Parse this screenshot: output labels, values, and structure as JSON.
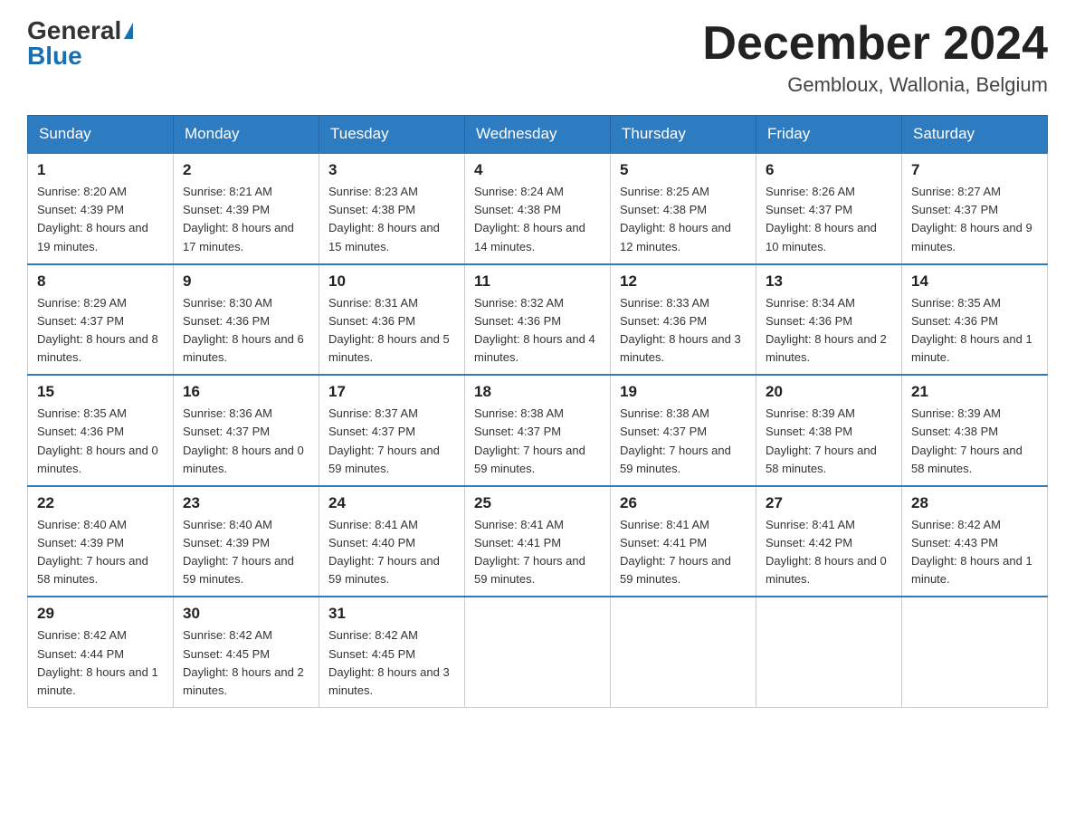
{
  "header": {
    "logo_general": "General",
    "logo_blue": "Blue",
    "month_title": "December 2024",
    "location": "Gembloux, Wallonia, Belgium"
  },
  "days_of_week": [
    "Sunday",
    "Monday",
    "Tuesday",
    "Wednesday",
    "Thursday",
    "Friday",
    "Saturday"
  ],
  "weeks": [
    [
      {
        "day": "1",
        "sunrise": "8:20 AM",
        "sunset": "4:39 PM",
        "daylight": "8 hours and 19 minutes."
      },
      {
        "day": "2",
        "sunrise": "8:21 AM",
        "sunset": "4:39 PM",
        "daylight": "8 hours and 17 minutes."
      },
      {
        "day": "3",
        "sunrise": "8:23 AM",
        "sunset": "4:38 PM",
        "daylight": "8 hours and 15 minutes."
      },
      {
        "day": "4",
        "sunrise": "8:24 AM",
        "sunset": "4:38 PM",
        "daylight": "8 hours and 14 minutes."
      },
      {
        "day": "5",
        "sunrise": "8:25 AM",
        "sunset": "4:38 PM",
        "daylight": "8 hours and 12 minutes."
      },
      {
        "day": "6",
        "sunrise": "8:26 AM",
        "sunset": "4:37 PM",
        "daylight": "8 hours and 10 minutes."
      },
      {
        "day": "7",
        "sunrise": "8:27 AM",
        "sunset": "4:37 PM",
        "daylight": "8 hours and 9 minutes."
      }
    ],
    [
      {
        "day": "8",
        "sunrise": "8:29 AM",
        "sunset": "4:37 PM",
        "daylight": "8 hours and 8 minutes."
      },
      {
        "day": "9",
        "sunrise": "8:30 AM",
        "sunset": "4:36 PM",
        "daylight": "8 hours and 6 minutes."
      },
      {
        "day": "10",
        "sunrise": "8:31 AM",
        "sunset": "4:36 PM",
        "daylight": "8 hours and 5 minutes."
      },
      {
        "day": "11",
        "sunrise": "8:32 AM",
        "sunset": "4:36 PM",
        "daylight": "8 hours and 4 minutes."
      },
      {
        "day": "12",
        "sunrise": "8:33 AM",
        "sunset": "4:36 PM",
        "daylight": "8 hours and 3 minutes."
      },
      {
        "day": "13",
        "sunrise": "8:34 AM",
        "sunset": "4:36 PM",
        "daylight": "8 hours and 2 minutes."
      },
      {
        "day": "14",
        "sunrise": "8:35 AM",
        "sunset": "4:36 PM",
        "daylight": "8 hours and 1 minute."
      }
    ],
    [
      {
        "day": "15",
        "sunrise": "8:35 AM",
        "sunset": "4:36 PM",
        "daylight": "8 hours and 0 minutes."
      },
      {
        "day": "16",
        "sunrise": "8:36 AM",
        "sunset": "4:37 PM",
        "daylight": "8 hours and 0 minutes."
      },
      {
        "day": "17",
        "sunrise": "8:37 AM",
        "sunset": "4:37 PM",
        "daylight": "7 hours and 59 minutes."
      },
      {
        "day": "18",
        "sunrise": "8:38 AM",
        "sunset": "4:37 PM",
        "daylight": "7 hours and 59 minutes."
      },
      {
        "day": "19",
        "sunrise": "8:38 AM",
        "sunset": "4:37 PM",
        "daylight": "7 hours and 59 minutes."
      },
      {
        "day": "20",
        "sunrise": "8:39 AM",
        "sunset": "4:38 PM",
        "daylight": "7 hours and 58 minutes."
      },
      {
        "day": "21",
        "sunrise": "8:39 AM",
        "sunset": "4:38 PM",
        "daylight": "7 hours and 58 minutes."
      }
    ],
    [
      {
        "day": "22",
        "sunrise": "8:40 AM",
        "sunset": "4:39 PM",
        "daylight": "7 hours and 58 minutes."
      },
      {
        "day": "23",
        "sunrise": "8:40 AM",
        "sunset": "4:39 PM",
        "daylight": "7 hours and 59 minutes."
      },
      {
        "day": "24",
        "sunrise": "8:41 AM",
        "sunset": "4:40 PM",
        "daylight": "7 hours and 59 minutes."
      },
      {
        "day": "25",
        "sunrise": "8:41 AM",
        "sunset": "4:41 PM",
        "daylight": "7 hours and 59 minutes."
      },
      {
        "day": "26",
        "sunrise": "8:41 AM",
        "sunset": "4:41 PM",
        "daylight": "7 hours and 59 minutes."
      },
      {
        "day": "27",
        "sunrise": "8:41 AM",
        "sunset": "4:42 PM",
        "daylight": "8 hours and 0 minutes."
      },
      {
        "day": "28",
        "sunrise": "8:42 AM",
        "sunset": "4:43 PM",
        "daylight": "8 hours and 1 minute."
      }
    ],
    [
      {
        "day": "29",
        "sunrise": "8:42 AM",
        "sunset": "4:44 PM",
        "daylight": "8 hours and 1 minute."
      },
      {
        "day": "30",
        "sunrise": "8:42 AM",
        "sunset": "4:45 PM",
        "daylight": "8 hours and 2 minutes."
      },
      {
        "day": "31",
        "sunrise": "8:42 AM",
        "sunset": "4:45 PM",
        "daylight": "8 hours and 3 minutes."
      },
      null,
      null,
      null,
      null
    ]
  ],
  "labels": {
    "sunrise": "Sunrise:",
    "sunset": "Sunset:",
    "daylight": "Daylight:"
  }
}
